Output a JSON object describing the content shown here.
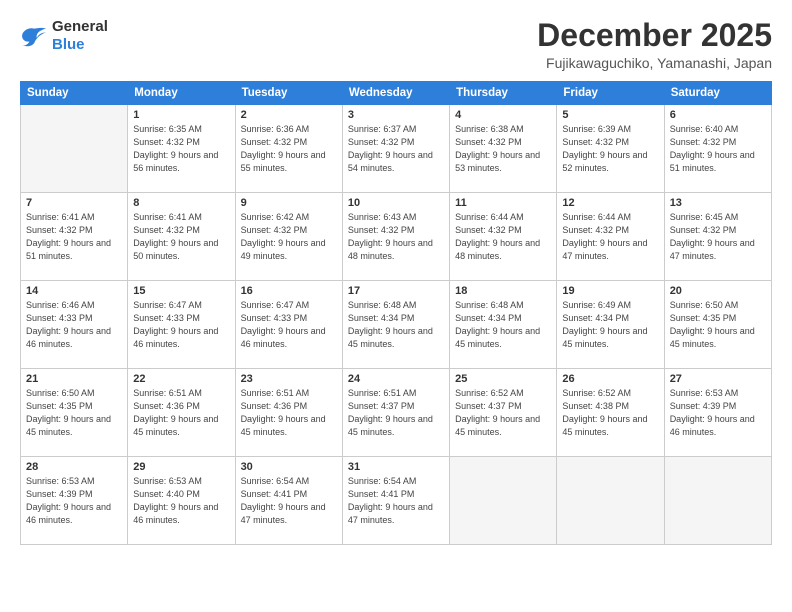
{
  "logo": {
    "general": "General",
    "blue": "Blue"
  },
  "header": {
    "title": "December 2025",
    "subtitle": "Fujikawaguchiko, Yamanashi, Japan"
  },
  "weekdays": [
    "Sunday",
    "Monday",
    "Tuesday",
    "Wednesday",
    "Thursday",
    "Friday",
    "Saturday"
  ],
  "weeks": [
    [
      {
        "day": "",
        "sunrise": "",
        "sunset": "",
        "daylight": "",
        "empty": true
      },
      {
        "day": "1",
        "sunrise": "Sunrise: 6:35 AM",
        "sunset": "Sunset: 4:32 PM",
        "daylight": "Daylight: 9 hours and 56 minutes.",
        "empty": false
      },
      {
        "day": "2",
        "sunrise": "Sunrise: 6:36 AM",
        "sunset": "Sunset: 4:32 PM",
        "daylight": "Daylight: 9 hours and 55 minutes.",
        "empty": false
      },
      {
        "day": "3",
        "sunrise": "Sunrise: 6:37 AM",
        "sunset": "Sunset: 4:32 PM",
        "daylight": "Daylight: 9 hours and 54 minutes.",
        "empty": false
      },
      {
        "day": "4",
        "sunrise": "Sunrise: 6:38 AM",
        "sunset": "Sunset: 4:32 PM",
        "daylight": "Daylight: 9 hours and 53 minutes.",
        "empty": false
      },
      {
        "day": "5",
        "sunrise": "Sunrise: 6:39 AM",
        "sunset": "Sunset: 4:32 PM",
        "daylight": "Daylight: 9 hours and 52 minutes.",
        "empty": false
      },
      {
        "day": "6",
        "sunrise": "Sunrise: 6:40 AM",
        "sunset": "Sunset: 4:32 PM",
        "daylight": "Daylight: 9 hours and 51 minutes.",
        "empty": false
      }
    ],
    [
      {
        "day": "7",
        "sunrise": "Sunrise: 6:41 AM",
        "sunset": "Sunset: 4:32 PM",
        "daylight": "Daylight: 9 hours and 51 minutes.",
        "empty": false
      },
      {
        "day": "8",
        "sunrise": "Sunrise: 6:41 AM",
        "sunset": "Sunset: 4:32 PM",
        "daylight": "Daylight: 9 hours and 50 minutes.",
        "empty": false
      },
      {
        "day": "9",
        "sunrise": "Sunrise: 6:42 AM",
        "sunset": "Sunset: 4:32 PM",
        "daylight": "Daylight: 9 hours and 49 minutes.",
        "empty": false
      },
      {
        "day": "10",
        "sunrise": "Sunrise: 6:43 AM",
        "sunset": "Sunset: 4:32 PM",
        "daylight": "Daylight: 9 hours and 48 minutes.",
        "empty": false
      },
      {
        "day": "11",
        "sunrise": "Sunrise: 6:44 AM",
        "sunset": "Sunset: 4:32 PM",
        "daylight": "Daylight: 9 hours and 48 minutes.",
        "empty": false
      },
      {
        "day": "12",
        "sunrise": "Sunrise: 6:44 AM",
        "sunset": "Sunset: 4:32 PM",
        "daylight": "Daylight: 9 hours and 47 minutes.",
        "empty": false
      },
      {
        "day": "13",
        "sunrise": "Sunrise: 6:45 AM",
        "sunset": "Sunset: 4:32 PM",
        "daylight": "Daylight: 9 hours and 47 minutes.",
        "empty": false
      }
    ],
    [
      {
        "day": "14",
        "sunrise": "Sunrise: 6:46 AM",
        "sunset": "Sunset: 4:33 PM",
        "daylight": "Daylight: 9 hours and 46 minutes.",
        "empty": false
      },
      {
        "day": "15",
        "sunrise": "Sunrise: 6:47 AM",
        "sunset": "Sunset: 4:33 PM",
        "daylight": "Daylight: 9 hours and 46 minutes.",
        "empty": false
      },
      {
        "day": "16",
        "sunrise": "Sunrise: 6:47 AM",
        "sunset": "Sunset: 4:33 PM",
        "daylight": "Daylight: 9 hours and 46 minutes.",
        "empty": false
      },
      {
        "day": "17",
        "sunrise": "Sunrise: 6:48 AM",
        "sunset": "Sunset: 4:34 PM",
        "daylight": "Daylight: 9 hours and 45 minutes.",
        "empty": false
      },
      {
        "day": "18",
        "sunrise": "Sunrise: 6:48 AM",
        "sunset": "Sunset: 4:34 PM",
        "daylight": "Daylight: 9 hours and 45 minutes.",
        "empty": false
      },
      {
        "day": "19",
        "sunrise": "Sunrise: 6:49 AM",
        "sunset": "Sunset: 4:34 PM",
        "daylight": "Daylight: 9 hours and 45 minutes.",
        "empty": false
      },
      {
        "day": "20",
        "sunrise": "Sunrise: 6:50 AM",
        "sunset": "Sunset: 4:35 PM",
        "daylight": "Daylight: 9 hours and 45 minutes.",
        "empty": false
      }
    ],
    [
      {
        "day": "21",
        "sunrise": "Sunrise: 6:50 AM",
        "sunset": "Sunset: 4:35 PM",
        "daylight": "Daylight: 9 hours and 45 minutes.",
        "empty": false
      },
      {
        "day": "22",
        "sunrise": "Sunrise: 6:51 AM",
        "sunset": "Sunset: 4:36 PM",
        "daylight": "Daylight: 9 hours and 45 minutes.",
        "empty": false
      },
      {
        "day": "23",
        "sunrise": "Sunrise: 6:51 AM",
        "sunset": "Sunset: 4:36 PM",
        "daylight": "Daylight: 9 hours and 45 minutes.",
        "empty": false
      },
      {
        "day": "24",
        "sunrise": "Sunrise: 6:51 AM",
        "sunset": "Sunset: 4:37 PM",
        "daylight": "Daylight: 9 hours and 45 minutes.",
        "empty": false
      },
      {
        "day": "25",
        "sunrise": "Sunrise: 6:52 AM",
        "sunset": "Sunset: 4:37 PM",
        "daylight": "Daylight: 9 hours and 45 minutes.",
        "empty": false
      },
      {
        "day": "26",
        "sunrise": "Sunrise: 6:52 AM",
        "sunset": "Sunset: 4:38 PM",
        "daylight": "Daylight: 9 hours and 45 minutes.",
        "empty": false
      },
      {
        "day": "27",
        "sunrise": "Sunrise: 6:53 AM",
        "sunset": "Sunset: 4:39 PM",
        "daylight": "Daylight: 9 hours and 46 minutes.",
        "empty": false
      }
    ],
    [
      {
        "day": "28",
        "sunrise": "Sunrise: 6:53 AM",
        "sunset": "Sunset: 4:39 PM",
        "daylight": "Daylight: 9 hours and 46 minutes.",
        "empty": false
      },
      {
        "day": "29",
        "sunrise": "Sunrise: 6:53 AM",
        "sunset": "Sunset: 4:40 PM",
        "daylight": "Daylight: 9 hours and 46 minutes.",
        "empty": false
      },
      {
        "day": "30",
        "sunrise": "Sunrise: 6:54 AM",
        "sunset": "Sunset: 4:41 PM",
        "daylight": "Daylight: 9 hours and 47 minutes.",
        "empty": false
      },
      {
        "day": "31",
        "sunrise": "Sunrise: 6:54 AM",
        "sunset": "Sunset: 4:41 PM",
        "daylight": "Daylight: 9 hours and 47 minutes.",
        "empty": false
      },
      {
        "day": "",
        "sunrise": "",
        "sunset": "",
        "daylight": "",
        "empty": true
      },
      {
        "day": "",
        "sunrise": "",
        "sunset": "",
        "daylight": "",
        "empty": true
      },
      {
        "day": "",
        "sunrise": "",
        "sunset": "",
        "daylight": "",
        "empty": true
      }
    ]
  ]
}
